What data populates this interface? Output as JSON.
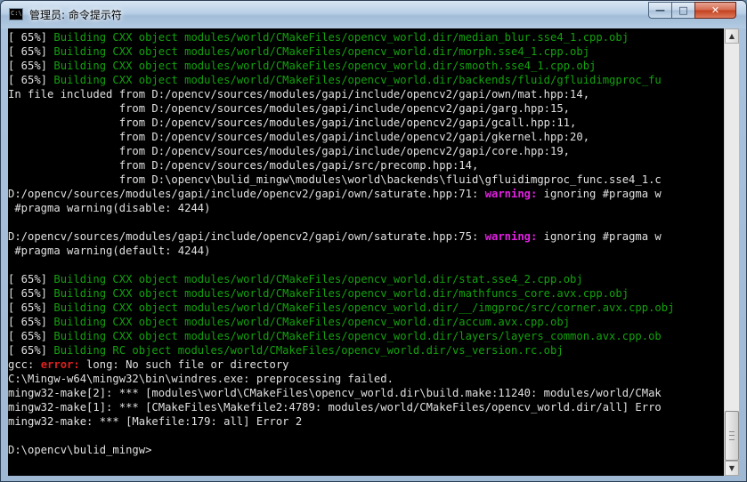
{
  "window": {
    "title": "管理员: 命令提示符",
    "icon_label": "C:\\.",
    "controls": {
      "minimize": "—",
      "maximize": "□",
      "close": "✕"
    }
  },
  "console": {
    "lines": [
      [
        {
          "t": "[ 65%] ",
          "c": "w"
        },
        {
          "t": "Building CXX object modules/world/CMakeFiles/opencv_world.dir/median_blur.sse4_1.cpp.obj",
          "c": "g"
        }
      ],
      [
        {
          "t": "[ 65%] ",
          "c": "w"
        },
        {
          "t": "Building CXX object modules/world/CMakeFiles/opencv_world.dir/morph.sse4_1.cpp.obj",
          "c": "g"
        }
      ],
      [
        {
          "t": "[ 65%] ",
          "c": "w"
        },
        {
          "t": "Building CXX object modules/world/CMakeFiles/opencv_world.dir/smooth.sse4_1.cpp.obj",
          "c": "g"
        }
      ],
      [
        {
          "t": "[ 65%] ",
          "c": "w"
        },
        {
          "t": "Building CXX object modules/world/CMakeFiles/opencv_world.dir/backends/fluid/gfluidimgproc_fu",
          "c": "g"
        }
      ],
      [
        {
          "t": "In file included from D:/opencv/sources/modules/gapi/include/opencv2/gapi/own/mat.hpp:14,",
          "c": "w"
        }
      ],
      [
        {
          "t": "                 from D:/opencv/sources/modules/gapi/include/opencv2/gapi/garg.hpp:15,",
          "c": "w"
        }
      ],
      [
        {
          "t": "                 from D:/opencv/sources/modules/gapi/include/opencv2/gapi/gcall.hpp:11,",
          "c": "w"
        }
      ],
      [
        {
          "t": "                 from D:/opencv/sources/modules/gapi/include/opencv2/gapi/gkernel.hpp:20,",
          "c": "w"
        }
      ],
      [
        {
          "t": "                 from D:/opencv/sources/modules/gapi/include/opencv2/gapi/core.hpp:19,",
          "c": "w"
        }
      ],
      [
        {
          "t": "                 from D:/opencv/sources/modules/gapi/src/precomp.hpp:14,",
          "c": "w"
        }
      ],
      [
        {
          "t": "                 from D:\\opencv\\bulid_mingw\\modules\\world\\backends\\fluid\\gfluidimgproc_func.sse4_1.c",
          "c": "w"
        }
      ],
      [
        {
          "t": "D:/opencv/sources/modules/gapi/include/opencv2/gapi/own/saturate.hpp:71: ",
          "c": "w"
        },
        {
          "t": "warning:",
          "c": "m"
        },
        {
          "t": " ignoring #pragma w",
          "c": "w"
        }
      ],
      [
        {
          "t": " #pragma warning(disable: 4244)",
          "c": "w"
        }
      ],
      [
        {
          "t": "",
          "c": "w"
        }
      ],
      [
        {
          "t": "D:/opencv/sources/modules/gapi/include/opencv2/gapi/own/saturate.hpp:75: ",
          "c": "w"
        },
        {
          "t": "warning:",
          "c": "m"
        },
        {
          "t": " ignoring #pragma w",
          "c": "w"
        }
      ],
      [
        {
          "t": " #pragma warning(default: 4244)",
          "c": "w"
        }
      ],
      [
        {
          "t": "",
          "c": "w"
        }
      ],
      [
        {
          "t": "[ 65%] ",
          "c": "w"
        },
        {
          "t": "Building CXX object modules/world/CMakeFiles/opencv_world.dir/stat.sse4_2.cpp.obj",
          "c": "g"
        }
      ],
      [
        {
          "t": "[ 65%] ",
          "c": "w"
        },
        {
          "t": "Building CXX object modules/world/CMakeFiles/opencv_world.dir/mathfuncs_core.avx.cpp.obj",
          "c": "g"
        }
      ],
      [
        {
          "t": "[ 65%] ",
          "c": "w"
        },
        {
          "t": "Building CXX object modules/world/CMakeFiles/opencv_world.dir/__/imgproc/src/corner.avx.cpp.obj",
          "c": "g"
        }
      ],
      [
        {
          "t": "[ 65%] ",
          "c": "w"
        },
        {
          "t": "Building CXX object modules/world/CMakeFiles/opencv_world.dir/accum.avx.cpp.obj",
          "c": "g"
        }
      ],
      [
        {
          "t": "[ 65%] ",
          "c": "w"
        },
        {
          "t": "Building CXX object modules/world/CMakeFiles/opencv_world.dir/layers/layers_common.avx.cpp.ob",
          "c": "g"
        }
      ],
      [
        {
          "t": "[ 65%] ",
          "c": "w"
        },
        {
          "t": "Building RC object modules/world/CMakeFiles/opencv_world.dir/vs_version.rc.obj",
          "c": "g"
        }
      ],
      [
        {
          "t": "gcc: ",
          "c": "w"
        },
        {
          "t": "error:",
          "c": "r"
        },
        {
          "t": " long: No such file or directory",
          "c": "w"
        }
      ],
      [
        {
          "t": "C:\\Mingw-w64\\mingw32\\bin\\windres.exe: preprocessing failed.",
          "c": "w"
        }
      ],
      [
        {
          "t": "mingw32-make[2]: *** [modules\\world\\CMakeFiles\\opencv_world.dir\\build.make:11240: modules/world/CMak",
          "c": "w"
        }
      ],
      [
        {
          "t": "mingw32-make[1]: *** [CMakeFiles\\Makefile2:4789: modules/world/CMakeFiles/opencv_world.dir/all] Erro",
          "c": "w"
        }
      ],
      [
        {
          "t": "mingw32-make: *** [Makefile:179: all] Error 2",
          "c": "w"
        }
      ],
      [
        {
          "t": "",
          "c": "w"
        }
      ],
      [
        {
          "t": "D:\\opencv\\bulid_mingw>",
          "c": "w"
        }
      ]
    ],
    "colors": {
      "w": "#c0c0c0",
      "g": "#13a10e",
      "m": "#e020e0",
      "r": "#e02020",
      "background": "#000000"
    }
  },
  "scrollbar": {
    "up_arrow": "▲",
    "down_arrow": "▼"
  }
}
